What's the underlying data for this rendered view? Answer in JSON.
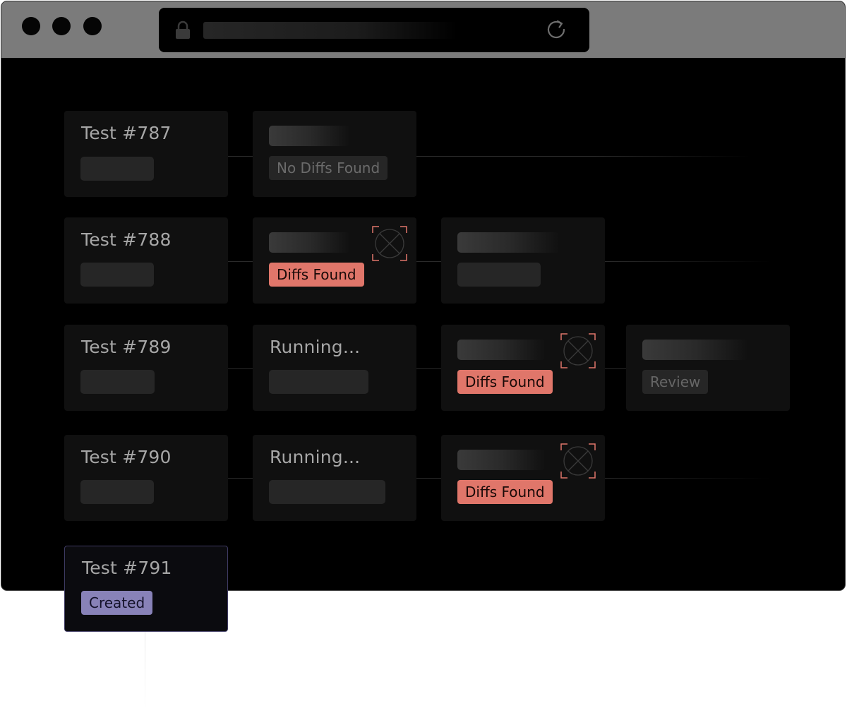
{
  "browser": {
    "controls": [
      "close",
      "minimize",
      "maximize"
    ],
    "lock_icon": "lock-icon",
    "reload_icon": "reload-icon"
  },
  "colors": {
    "diff_badge": "#e0766a",
    "created_badge": "#8882b8",
    "card_background": "#101010",
    "canvas_background": "#000000",
    "titlebar": "#7b7b7b"
  },
  "tests": [
    {
      "title": "Test #787",
      "steps": [
        {
          "status": "No Diffs Found"
        }
      ]
    },
    {
      "title": "Test #788",
      "steps": [
        {
          "status": "Diffs Found",
          "icon": "diff-focus-icon"
        },
        {
          "status": ""
        }
      ]
    },
    {
      "title": "Test #789",
      "steps": [
        {
          "status": "Running..."
        },
        {
          "status": "Diffs Found",
          "icon": "diff-focus-icon"
        },
        {
          "status": "Review"
        }
      ]
    },
    {
      "title": "Test #790",
      "steps": [
        {
          "status": "Running..."
        },
        {
          "status": "Diffs Found",
          "icon": "diff-focus-icon"
        }
      ]
    },
    {
      "title": "Test #791",
      "status": "Created"
    }
  ]
}
